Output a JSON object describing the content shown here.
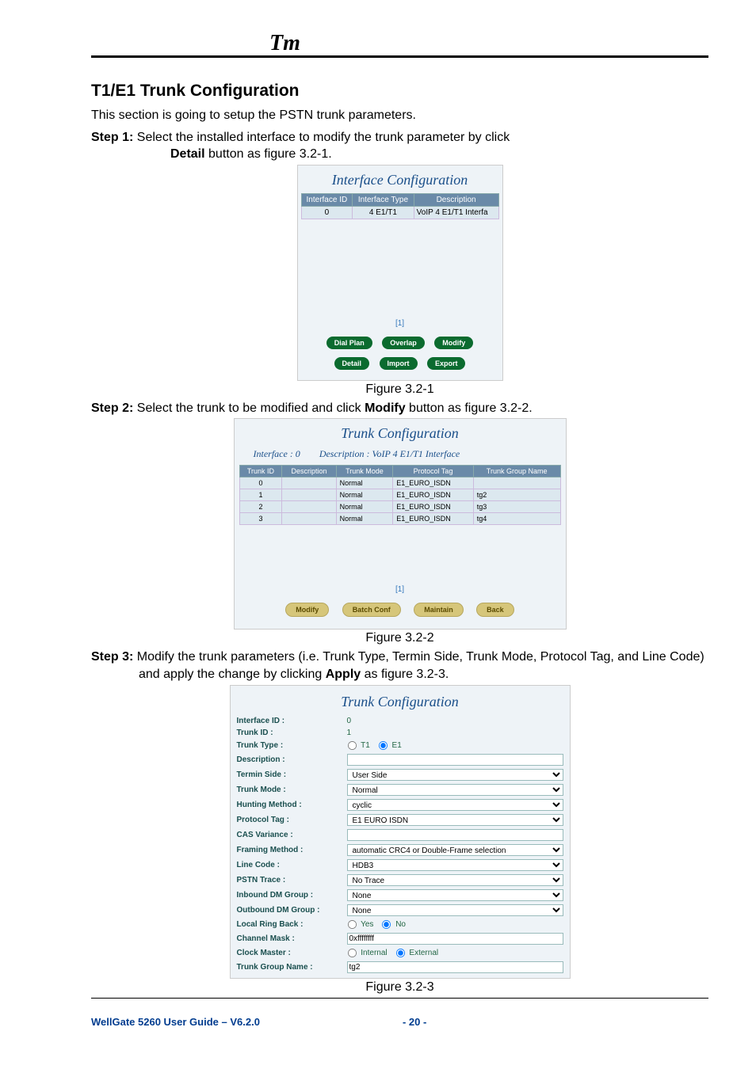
{
  "doc": {
    "section_title": "T1/E1 Trunk Configuration",
    "intro": "This section is going to setup the PSTN trunk parameters.",
    "step1_prefix": "Step 1:",
    "step1_text": " Select the installed interface to modify the trunk parameter by click ",
    "step1_bold": "Detail",
    "step1_tail": " button as figure 3.2-1.",
    "fig1_caption": "Figure 3.2-1",
    "step2_prefix": "Step 2:",
    "step2_text": " Select the trunk to be modified and click ",
    "step2_bold": "Modify",
    "step2_tail": " button as figure 3.2-2.",
    "fig2_caption": "Figure 3.2-2",
    "step3_prefix": "Step 3:",
    "step3_text": " Modify the trunk parameters (i.e. Trunk Type, Termin Side, Trunk Mode, Protocol Tag, and Line Code) and apply the change by clicking ",
    "step3_bold": "Apply",
    "step3_tail": " as figure 3.2-3.",
    "fig3_caption": "Figure 3.2-3"
  },
  "shot1": {
    "title": "Interface Configuration",
    "headers": [
      "Interface ID",
      "Interface Type",
      "Description"
    ],
    "row": {
      "id": "0",
      "type": "4 E1/T1",
      "desc": "VoIP 4 E1/T1 Interfa"
    },
    "pager": "[1]",
    "buttons_row1": [
      "Dial Plan",
      "Overlap",
      "Modify"
    ],
    "buttons_row2": [
      "Detail",
      "Import",
      "Export"
    ]
  },
  "shot2": {
    "title": "Trunk Configuration",
    "sub_left": "Interface : 0",
    "sub_right": "Description : VoIP 4 E1/T1 Interface",
    "headers": [
      "Trunk ID",
      "Description",
      "Trunk Mode",
      "Protocol Tag",
      "Trunk Group Name"
    ],
    "rows": [
      {
        "id": "0",
        "desc": "",
        "mode": "Normal",
        "proto": "E1_EURO_ISDN",
        "tg": ""
      },
      {
        "id": "1",
        "desc": "",
        "mode": "Normal",
        "proto": "E1_EURO_ISDN",
        "tg": "tg2"
      },
      {
        "id": "2",
        "desc": "",
        "mode": "Normal",
        "proto": "E1_EURO_ISDN",
        "tg": "tg3"
      },
      {
        "id": "3",
        "desc": "",
        "mode": "Normal",
        "proto": "E1_EURO_ISDN",
        "tg": "tg4"
      }
    ],
    "pager": "[1]",
    "buttons": [
      "Modify",
      "Batch Conf",
      "Maintain",
      "Back"
    ]
  },
  "shot3": {
    "title": "Trunk Configuration",
    "rows": [
      {
        "label": "Interface ID :",
        "kind": "static",
        "value": "0"
      },
      {
        "label": "Trunk ID :",
        "kind": "static",
        "value": "1"
      },
      {
        "label": "Trunk Type :",
        "kind": "radio",
        "options": [
          {
            "v": "T1",
            "checked": false
          },
          {
            "v": "E1",
            "checked": true
          }
        ]
      },
      {
        "label": "Description :",
        "kind": "text",
        "value": ""
      },
      {
        "label": "Termin Side :",
        "kind": "select",
        "value": "User Side"
      },
      {
        "label": "Trunk Mode :",
        "kind": "select",
        "value": "Normal"
      },
      {
        "label": "Hunting Method :",
        "kind": "select",
        "value": "cyclic"
      },
      {
        "label": "Protocol Tag :",
        "kind": "select",
        "value": "E1 EURO ISDN"
      },
      {
        "label": "CAS Variance :",
        "kind": "text",
        "value": ""
      },
      {
        "label": "Framing Method :",
        "kind": "select",
        "value": "automatic CRC4 or Double-Frame selection"
      },
      {
        "label": "Line Code :",
        "kind": "select",
        "value": "HDB3"
      },
      {
        "label": "PSTN Trace :",
        "kind": "select",
        "value": "No Trace"
      },
      {
        "label": "Inbound DM Group :",
        "kind": "select",
        "value": "None"
      },
      {
        "label": "Outbound DM Group :",
        "kind": "select",
        "value": "None"
      },
      {
        "label": "Local Ring Back :",
        "kind": "radio",
        "options": [
          {
            "v": "Yes",
            "checked": false
          },
          {
            "v": "No",
            "checked": true
          }
        ]
      },
      {
        "label": "Channel Mask :",
        "kind": "text",
        "value": "0xffffffff"
      },
      {
        "label": "Clock Master :",
        "kind": "radio",
        "options": [
          {
            "v": "Internal",
            "checked": false
          },
          {
            "v": "External",
            "checked": true
          }
        ]
      },
      {
        "label": "Trunk Group Name :",
        "kind": "text",
        "value": "tg2"
      }
    ]
  },
  "footer": {
    "left": "WellGate 5260 User Guide – V6.2.0",
    "center": "- 20 -"
  }
}
